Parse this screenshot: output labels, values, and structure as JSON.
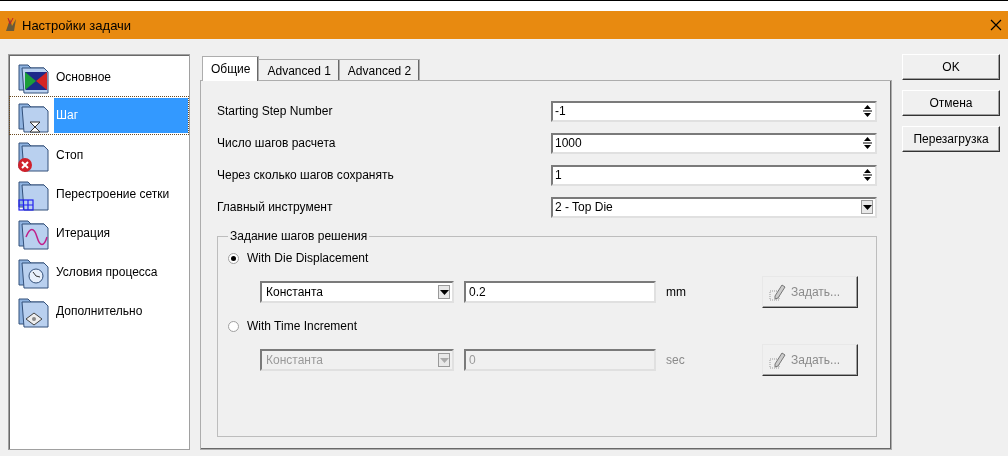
{
  "window": {
    "title": "Настройки задачи"
  },
  "sidebar": {
    "items": [
      {
        "label": "Основное",
        "selected": false
      },
      {
        "label": "Шаг",
        "selected": true
      },
      {
        "label": "Стоп",
        "selected": false
      },
      {
        "label": "Перестроение сетки",
        "selected": false
      },
      {
        "label": "Итерация",
        "selected": false
      },
      {
        "label": "Условия процесса",
        "selected": false
      },
      {
        "label": "Дополнительно",
        "selected": false
      }
    ]
  },
  "tabs": [
    {
      "label": "Общие",
      "selected": true
    },
    {
      "label": "Advanced 1",
      "selected": false
    },
    {
      "label": "Advanced 2",
      "selected": false
    }
  ],
  "fields": [
    {
      "kind": "spin",
      "label": "Starting Step Number",
      "value": "-1"
    },
    {
      "kind": "spin",
      "label": "Число шагов расчета",
      "value": "1000"
    },
    {
      "kind": "spin",
      "label": "Через сколько шагов сохранять",
      "value": "1"
    },
    {
      "kind": "dropdown",
      "label": "Главный инструмент",
      "value": "2  - Top Die"
    }
  ],
  "group": {
    "title": "Задание шагов решения",
    "options": [
      {
        "label": "With Die Displacement",
        "selected": true,
        "method": "Константа",
        "amount": "0.2",
        "unit": "mm",
        "disabled": false,
        "button": "Задать..."
      },
      {
        "label": "With Time Increment",
        "selected": false,
        "method": "Константа",
        "amount": "0",
        "unit": "sec",
        "disabled": true,
        "button": "Задать..."
      }
    ]
  },
  "buttons": [
    "OK",
    "Отмена",
    "Перезагрузка"
  ]
}
